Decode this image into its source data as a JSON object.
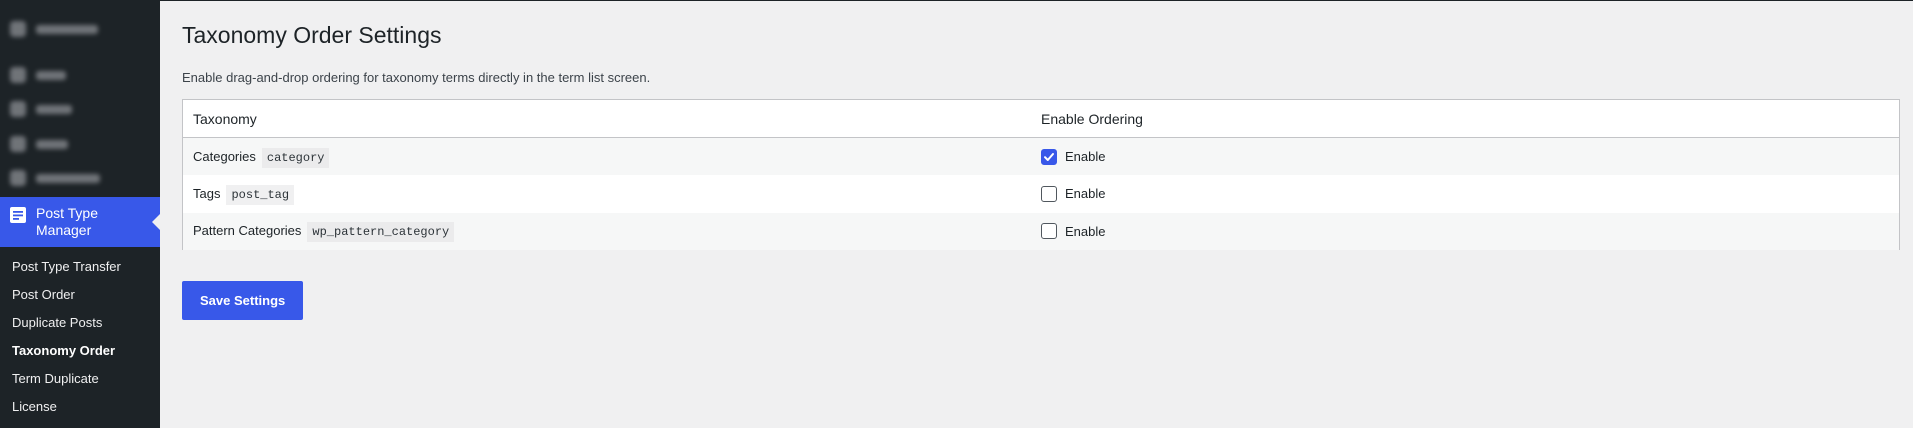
{
  "sidebar": {
    "active_item": {
      "label_line1": "Post Type",
      "label_line2": "Manager",
      "icon": "document-icon"
    },
    "submenu": [
      {
        "label": "Post Type Transfer",
        "current": false
      },
      {
        "label": "Post Order",
        "current": false
      },
      {
        "label": "Duplicate Posts",
        "current": false
      },
      {
        "label": "Taxonomy Order",
        "current": true
      },
      {
        "label": "Term Duplicate",
        "current": false
      },
      {
        "label": "License",
        "current": false
      }
    ]
  },
  "page": {
    "title": "Taxonomy Order Settings",
    "description": "Enable drag-and-drop ordering for taxonomy terms directly in the term list screen."
  },
  "table": {
    "headers": {
      "taxonomy": "Taxonomy",
      "enable_ordering": "Enable Ordering"
    },
    "rows": [
      {
        "label": "Categories",
        "slug": "category",
        "enabled": true,
        "checkbox_label": "Enable"
      },
      {
        "label": "Tags",
        "slug": "post_tag",
        "enabled": false,
        "checkbox_label": "Enable"
      },
      {
        "label": "Pattern Categories",
        "slug": "wp_pattern_category",
        "enabled": false,
        "checkbox_label": "Enable"
      }
    ]
  },
  "save_button": {
    "label": "Save Settings"
  },
  "colors": {
    "accent": "#3858e9",
    "sidebar_bg": "#1d2327",
    "page_bg": "#f0f0f1"
  }
}
